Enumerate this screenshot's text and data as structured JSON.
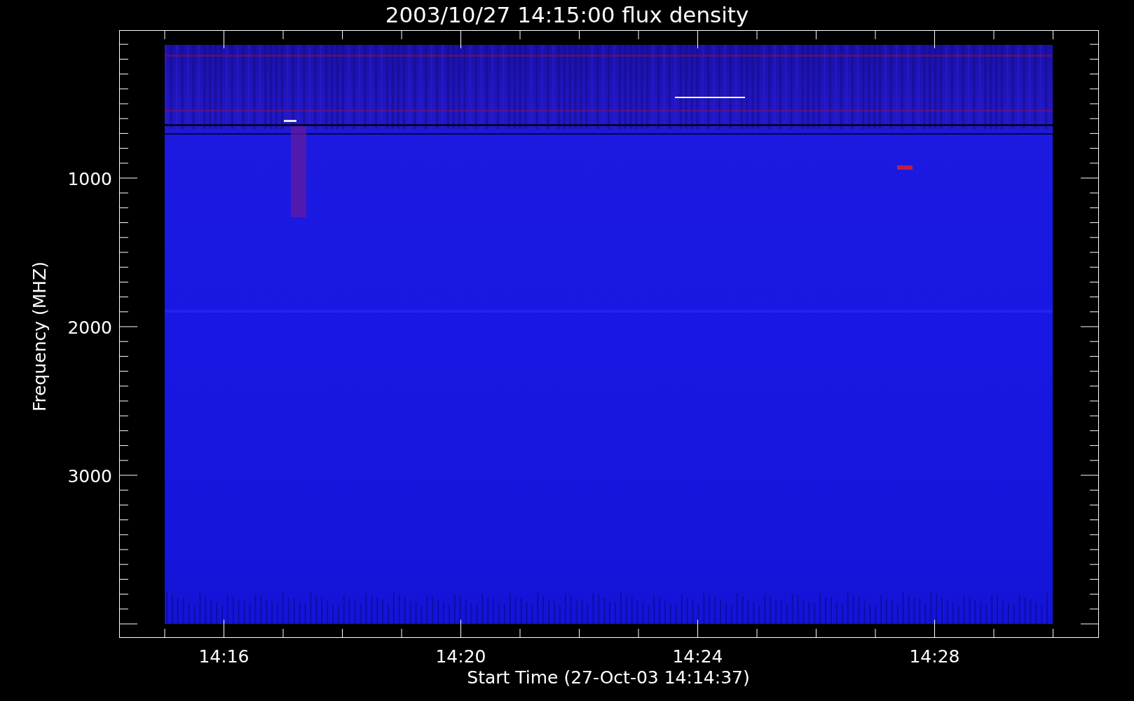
{
  "title": "2003/10/27 14:15:00 flux density",
  "y_axis": {
    "label": "Frequency (MHZ)",
    "ticks": [
      "1000",
      "2000",
      "3000"
    ]
  },
  "x_axis": {
    "label": "Start Time (27-Oct-03 14:14:37)",
    "ticks": [
      "14:16",
      "14:20",
      "14:24",
      "14:28"
    ]
  }
}
